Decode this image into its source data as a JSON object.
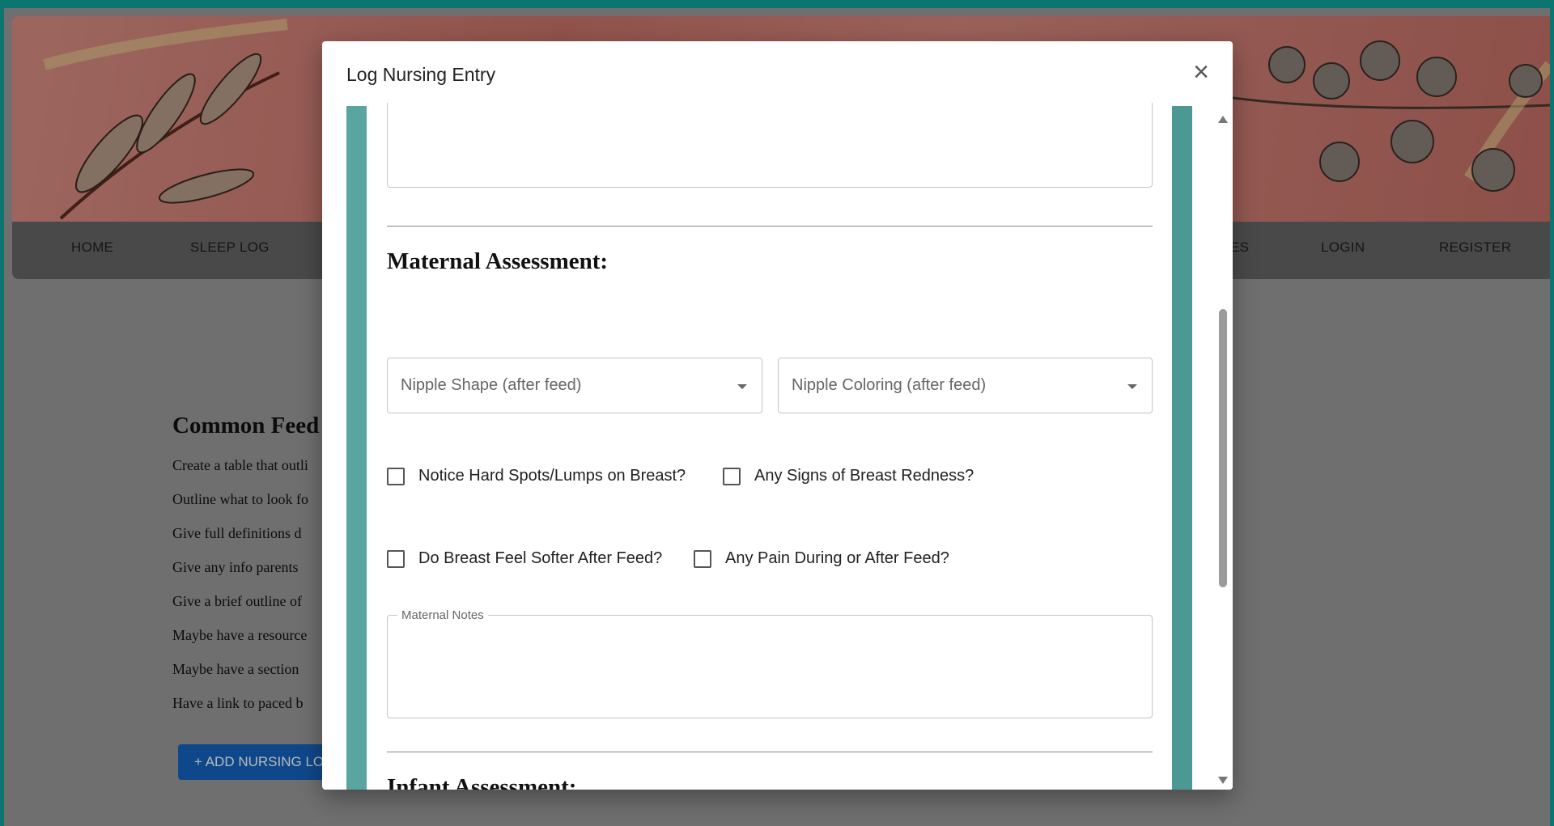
{
  "background_page": {
    "nav": {
      "home": "HOME",
      "sleep_log": "SLEEP LOG",
      "partial_item": "ES",
      "login": "LOGIN",
      "register": "REGISTER"
    },
    "content": {
      "heading": "Common Feed",
      "lines": [
        "Create a table that outli",
        "Outline what to look fo",
        "Give full definitions d",
        "Give any info parents",
        "Give a brief outline of",
        "Maybe have a resource",
        "Maybe have a section",
        "Have a link to paced b"
      ],
      "add_button": "+ ADD NURSING LO"
    }
  },
  "dialog": {
    "title": "Log Nursing Entry",
    "close_symbol": "×",
    "maternal": {
      "heading": "Maternal Assessment:",
      "nipple_shape_placeholder": "Nipple Shape (after feed)",
      "nipple_coloring_placeholder": "Nipple Coloring (after feed)",
      "checkboxes": [
        "Notice Hard Spots/Lumps on Breast?",
        "Any Signs of Breast Redness?",
        "Do Breast Feel Softer After Feed?",
        "Any Pain During or After Feed?"
      ],
      "notes_label": "Maternal Notes"
    },
    "infant": {
      "heading": "Infant Assessment:"
    }
  },
  "colors": {
    "frame_teal": "#10a39b",
    "panel_teal": "#4f9c98",
    "button_blue": "#1565c0"
  }
}
